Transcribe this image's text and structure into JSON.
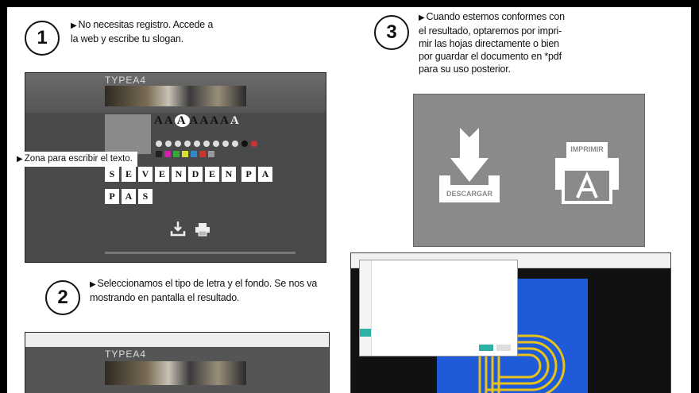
{
  "steps": [
    {
      "number": "1",
      "text_line1": "No necesitas registro. Accede a",
      "text_line2": "la web y escribe tu slogan."
    },
    {
      "number": "2",
      "text_line1": "Seleccionamos el tipo de letra y el fondo. Se nos va",
      "text_line2": "mostrando en pantalla el resultado."
    },
    {
      "number": "3",
      "text_line1": "Cuando estemos conformes con",
      "text_line2": "el resultado, optaremos por impri-",
      "text_line3": "mir las hojas directamente o bien",
      "text_line4": "por guardar el documento en *pdf",
      "text_line5": "para su uso posterior."
    }
  ],
  "screenshot1": {
    "logo": "TYPEA4",
    "callout": "Zona para escribir el texto.",
    "tiles_row1": [
      "S",
      "E",
      "V",
      "E",
      "N",
      "D",
      "E",
      "N",
      "P",
      "A"
    ],
    "tiles_row2": [
      "P",
      "A",
      "S"
    ],
    "font_glyphs": [
      "A",
      "A",
      "A",
      "A",
      "A",
      "A",
      "A",
      "A"
    ]
  },
  "screenshot2": {
    "logo": "TYPEA4"
  },
  "download_panel": {
    "download_label": "DESCARGAR",
    "print_label": "IMPRIMIR"
  },
  "colors": {
    "page_bg": "#000000",
    "sheet_bg": "#ffffff",
    "panel_gray": "#8a8a89",
    "poster_blue": "#1f5bd8",
    "poster_yellow": "#e8c21a"
  }
}
